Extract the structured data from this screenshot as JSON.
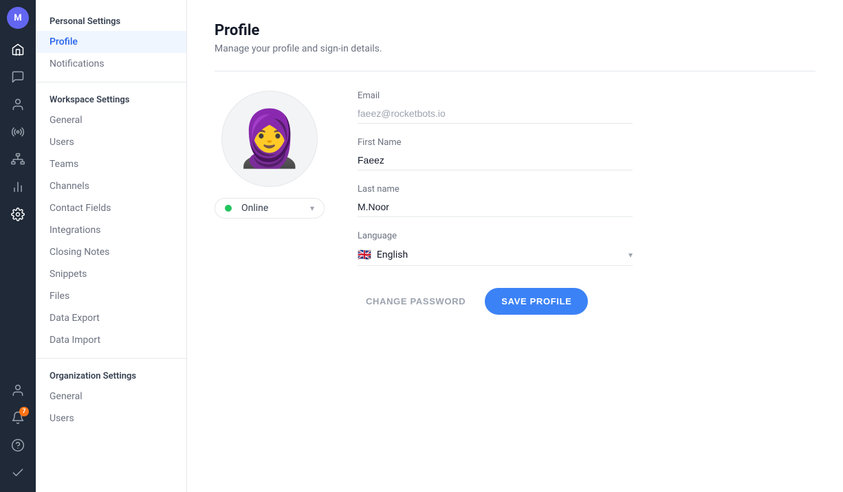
{
  "icon_sidebar": {
    "avatar_initials": "M",
    "avatar_color": "#6366f1"
  },
  "nav_sidebar": {
    "personal_settings_label": "Personal Settings",
    "items_personal": [
      {
        "id": "profile",
        "label": "Profile",
        "active": true
      },
      {
        "id": "notifications",
        "label": "Notifications",
        "active": false
      }
    ],
    "workspace_settings_label": "Workspace Settings",
    "items_workspace": [
      {
        "id": "general",
        "label": "General",
        "active": false
      },
      {
        "id": "users",
        "label": "Users",
        "active": false
      },
      {
        "id": "teams",
        "label": "Teams",
        "active": false
      },
      {
        "id": "channels",
        "label": "Channels",
        "active": false
      },
      {
        "id": "contact-fields",
        "label": "Contact Fields",
        "active": false
      },
      {
        "id": "integrations",
        "label": "Integrations",
        "active": false
      },
      {
        "id": "closing-notes",
        "label": "Closing Notes",
        "active": false
      },
      {
        "id": "snippets",
        "label": "Snippets",
        "active": false
      },
      {
        "id": "files",
        "label": "Files",
        "active": false
      },
      {
        "id": "data-export",
        "label": "Data Export",
        "active": false
      },
      {
        "id": "data-import",
        "label": "Data Import",
        "active": false
      }
    ],
    "organization_settings_label": "Organization Settings",
    "items_org": [
      {
        "id": "org-general",
        "label": "General",
        "active": false
      },
      {
        "id": "org-users",
        "label": "Users",
        "active": false
      }
    ]
  },
  "main": {
    "page_title": "Profile",
    "page_subtitle": "Manage your profile and sign-in details.",
    "email_label": "Email",
    "email_value": "faeez@rocketbots.io",
    "first_name_label": "First Name",
    "first_name_value": "Faeez",
    "last_name_label": "Last name",
    "last_name_value": "M.Noor",
    "language_label": "Language",
    "language_value": "English",
    "language_flag": "🇬🇧",
    "status_label": "Online",
    "change_password_label": "CHANGE PASSWORD",
    "save_profile_label": "SAVE PROFILE"
  },
  "notification_count": "7"
}
